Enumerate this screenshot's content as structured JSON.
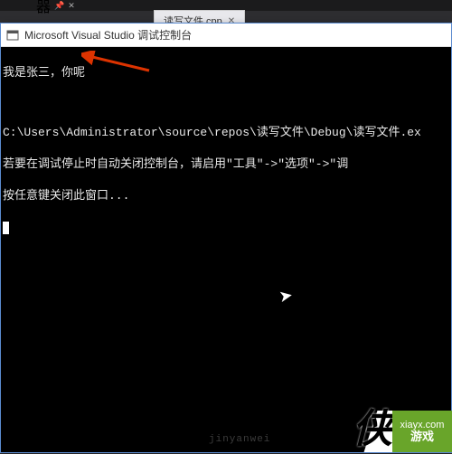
{
  "vs": {
    "truncated_label": "器",
    "tab_label": "读写文件.cpp"
  },
  "window": {
    "title": "Microsoft Visual Studio 调试控制台"
  },
  "console": {
    "line1": "我是张三，你呢",
    "line2": "C:\\Users\\Administrator\\source\\repos\\读写文件\\Debug\\读写文件.ex",
    "line3": "若要在调试停止时自动关闭控制台，请启用\"工具\"->\"选项\"->\"调",
    "line4": "按任意键关闭此窗口..."
  },
  "watermark": {
    "char": "侠",
    "url": "xiayx.com",
    "label": "游戏",
    "bd": "jinyanwei"
  }
}
